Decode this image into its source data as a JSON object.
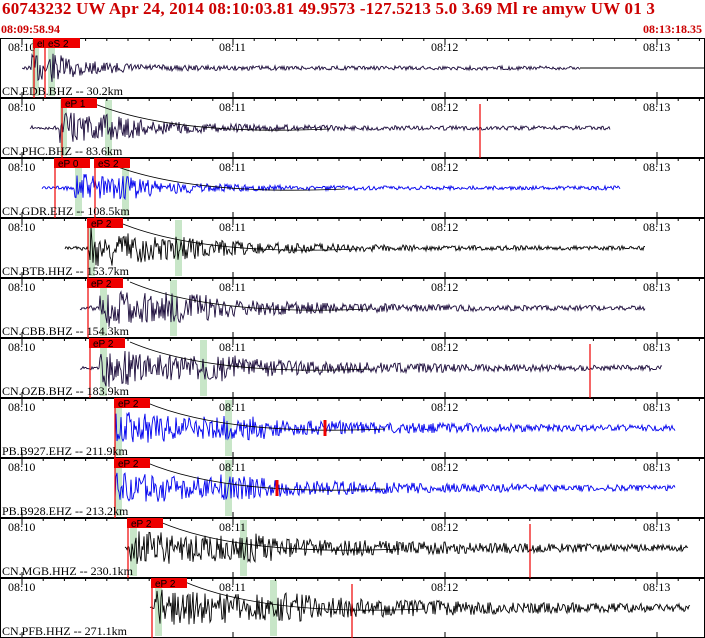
{
  "header": {
    "title": "60743232 UW Apr 24, 2014 08:10:03.81   49.9573 -127.5213  5.0 3.69 Ml re amyw UW 01   3",
    "start_time": "08:09:58.94",
    "end_time": "08:13:18.35"
  },
  "colors": {
    "header_text": "#cc0000",
    "pick": "#ee0000",
    "window": "#c8e6c8",
    "dark_trace": "#1a0a3a",
    "blue_trace": "#0000ee",
    "black_trace": "#000000"
  },
  "chart_data": {
    "type": "line",
    "x_ticks": [
      "08:10",
      "08:11",
      "08:12",
      "08:13"
    ],
    "traces": [
      {
        "label": "CN.EDB.BHZ -- 30.2km",
        "color": "dark",
        "picks": [
          "eP 0",
          "eS 2"
        ]
      },
      {
        "label": "CN.PHC.BHZ -- 83.6km",
        "color": "dark",
        "picks": [
          "eP 1"
        ]
      },
      {
        "label": "CN.GDR.EHZ -- 108.5km",
        "color": "blue",
        "picks": [
          "eP 0",
          "eS 2"
        ]
      },
      {
        "label": "CN.BTB.HHZ -- 153.7km",
        "color": "black",
        "picks": [
          "eP 2"
        ]
      },
      {
        "label": "CN.CBB.BHZ -- 154.3km",
        "color": "dark",
        "picks": [
          "eP 2"
        ]
      },
      {
        "label": "CN.OZB.BHZ -- 183.9km",
        "color": "dark",
        "picks": [
          "eP 2"
        ]
      },
      {
        "label": "PB.B927.EHZ -- 211.9km",
        "color": "blue",
        "picks": [
          "eP 2"
        ]
      },
      {
        "label": "PB.B928.EHZ -- 213.2km",
        "color": "blue",
        "picks": [
          "eP 2"
        ]
      },
      {
        "label": "CN.MGB.HHZ -- 230.1km",
        "color": "black",
        "picks": [
          "eP 2"
        ]
      },
      {
        "label": "CN.PFB.HHZ -- 271.1km",
        "color": "black",
        "picks": [
          "eP 2"
        ]
      }
    ]
  }
}
